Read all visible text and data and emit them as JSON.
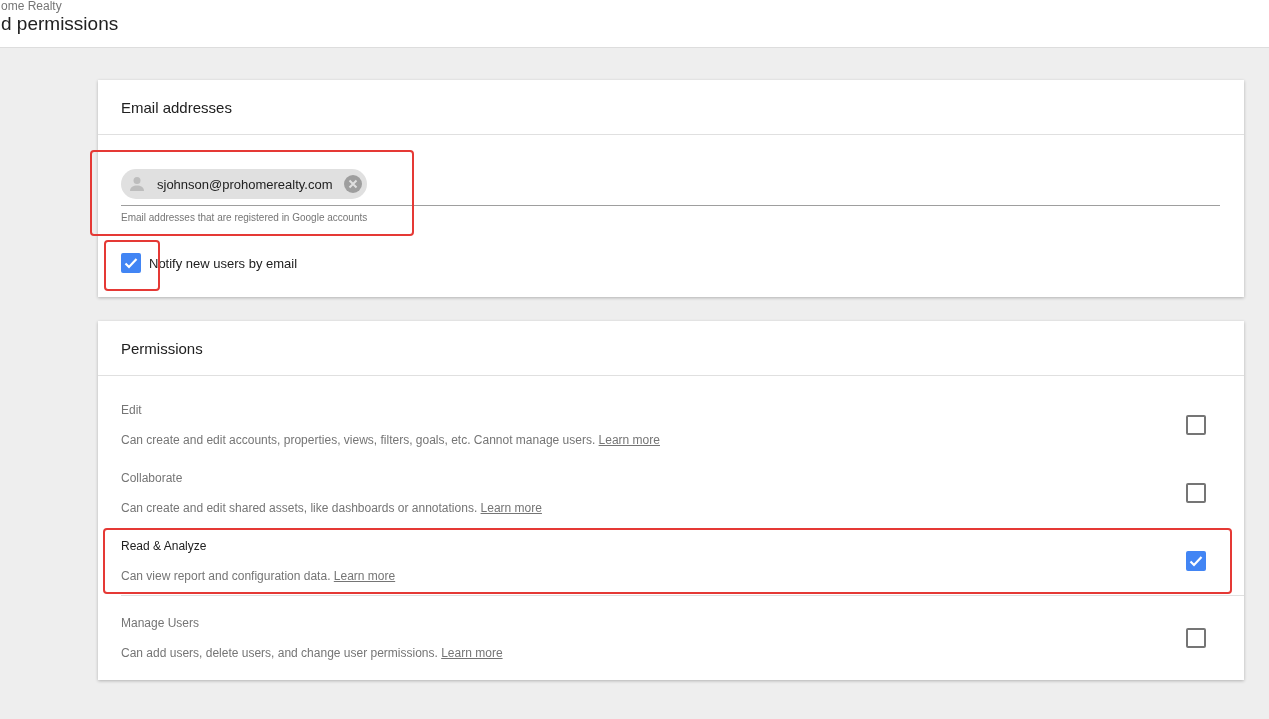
{
  "header": {
    "breadcrumb": "ome Realty",
    "title": "d permissions"
  },
  "email_card": {
    "title": "Email addresses",
    "chips": [
      {
        "label": "sjohnson@prohomerealty.com"
      }
    ],
    "hint": "Email addresses that are registered in Google accounts",
    "highlighted": true,
    "notify": {
      "label": "Notify new users by email",
      "checked": true,
      "highlighted": true
    }
  },
  "permissions_card": {
    "title": "Permissions",
    "items": [
      {
        "name": "Edit",
        "description": "Can create and edit accounts, properties, views, filters, goals, etc. Cannot manage users.",
        "link": "Learn more",
        "checked": false,
        "highlighted": false
      },
      {
        "name": "Collaborate",
        "description": "Can create and edit shared assets, like dashboards or annotations.",
        "link": "Learn more",
        "checked": false,
        "highlighted": false
      },
      {
        "name": "Read & Analyze",
        "description": "Can view report and configuration data.",
        "link": "Learn more",
        "checked": true,
        "highlighted": true
      },
      {
        "name": "Manage Users",
        "description": "Can add users, delete users, and change user permissions.",
        "link": "Learn more",
        "checked": false,
        "highlighted": false
      }
    ]
  }
}
